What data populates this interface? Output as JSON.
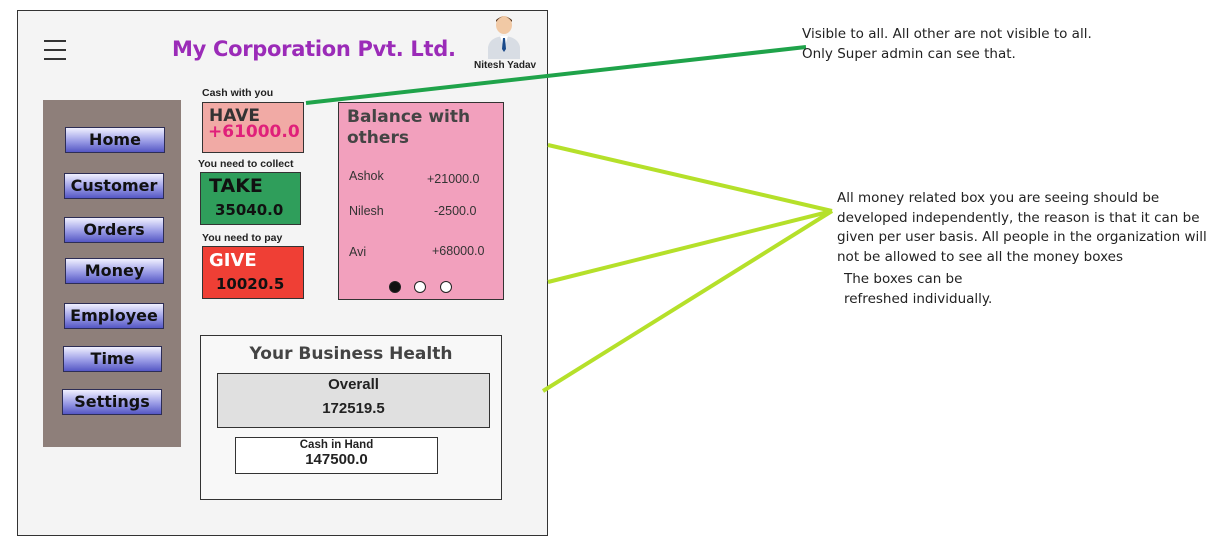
{
  "header": {
    "title": "My Corporation Pvt. Ltd.",
    "user_name": "Nitesh Yadav",
    "menu_icon": "hamburger-menu-icon",
    "avatar_icon": "user-avatar-icon"
  },
  "sidebar": {
    "items": [
      {
        "label": "Home"
      },
      {
        "label": "Customer"
      },
      {
        "label": "Orders"
      },
      {
        "label": "Money"
      },
      {
        "label": "Employee"
      },
      {
        "label": "Time"
      },
      {
        "label": "Settings"
      }
    ]
  },
  "money": {
    "have": {
      "caption": "Cash with you",
      "title": "HAVE",
      "value": "+61000.0"
    },
    "take": {
      "caption": "You need  to collect",
      "title": "TAKE",
      "value": "35040.0"
    },
    "give": {
      "caption": "You need  to pay",
      "title": "GIVE",
      "value": "10020.5"
    }
  },
  "balance": {
    "title": "Balance with others",
    "rows": [
      {
        "name": "Ashok",
        "amount": "+21000.0"
      },
      {
        "name": "Nilesh",
        "amount": "-2500.0"
      },
      {
        "name": "Avi",
        "amount": "+68000.0"
      }
    ],
    "page_active": 1,
    "page_count": 3
  },
  "health": {
    "title": "Your Business Health",
    "overall_label": "Overall",
    "overall_value": "172519.5",
    "cash_label": "Cash in Hand",
    "cash_value": "147500.0"
  },
  "annotations": {
    "note1_line1": "Visible to all. All other are not visible to all.",
    "note1_line2": "Only Super admin can see that.",
    "note2_line1": "All money related box you are seeing should be",
    "note2_line2": "developed independently, the reason is that it can be",
    "note2_line3": "given per user basis. All people in the organization will",
    "note2_line4": "not be allowed to see all the money boxes",
    "note3_line1": "The boxes can be",
    "note3_line2": "refreshed individually."
  },
  "colors": {
    "title": "#9b2bb8",
    "have_value": "#e0207a",
    "line_dark": "#1fa34a",
    "line_light": "#b5e02a"
  }
}
